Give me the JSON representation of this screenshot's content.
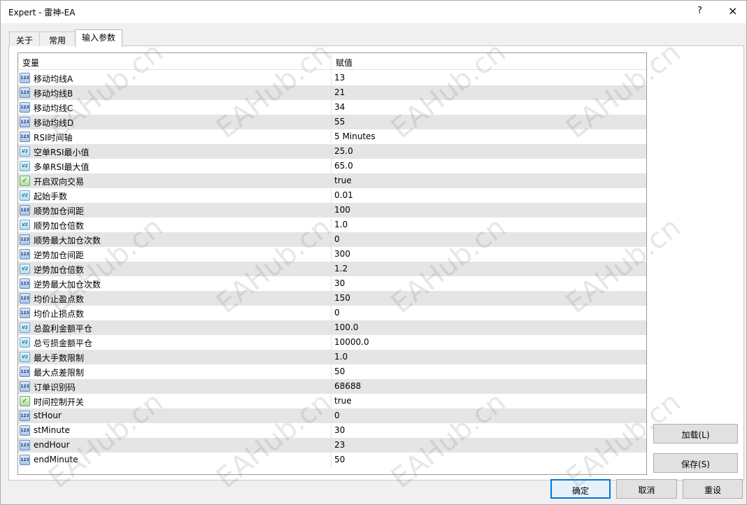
{
  "window": {
    "title": "Expert - 雷神-EA",
    "help_label": "?",
    "close_label": "×"
  },
  "tabs": [
    {
      "label": "关于"
    },
    {
      "label": "常用"
    },
    {
      "label": "输入参数"
    }
  ],
  "table": {
    "headers": [
      "变量",
      "赋值"
    ],
    "rows": [
      {
        "icon": "int",
        "icon_name": "integer-type-icon",
        "name": "移动均线A",
        "value": "13"
      },
      {
        "icon": "int",
        "icon_name": "integer-type-icon",
        "name": "移动均线B",
        "value": "21"
      },
      {
        "icon": "int",
        "icon_name": "integer-type-icon",
        "name": "移动均线C",
        "value": "34"
      },
      {
        "icon": "int",
        "icon_name": "integer-type-icon",
        "name": "移动均线D",
        "value": "55"
      },
      {
        "icon": "int",
        "icon_name": "integer-type-icon",
        "name": "RSI时间轴",
        "value": "5 Minutes"
      },
      {
        "icon": "dbl",
        "icon_name": "double-type-icon",
        "name": "空单RSI最小值",
        "value": "25.0"
      },
      {
        "icon": "dbl",
        "icon_name": "double-type-icon",
        "name": "多单RSI最大值",
        "value": "65.0"
      },
      {
        "icon": "bool",
        "icon_name": "boolean-type-icon",
        "name": "开启双向交易",
        "value": "true"
      },
      {
        "icon": "dbl",
        "icon_name": "double-type-icon",
        "name": "起始手数",
        "value": "0.01"
      },
      {
        "icon": "int",
        "icon_name": "integer-type-icon",
        "name": "顺势加仓间距",
        "value": "100"
      },
      {
        "icon": "dbl",
        "icon_name": "double-type-icon",
        "name": "顺势加仓倍数",
        "value": "1.0"
      },
      {
        "icon": "int",
        "icon_name": "integer-type-icon",
        "name": "顺势最大加仓次数",
        "value": "0"
      },
      {
        "icon": "int",
        "icon_name": "integer-type-icon",
        "name": "逆势加仓间距",
        "value": "300"
      },
      {
        "icon": "dbl",
        "icon_name": "double-type-icon",
        "name": "逆势加仓倍数",
        "value": "1.2"
      },
      {
        "icon": "int",
        "icon_name": "integer-type-icon",
        "name": "逆势最大加仓次数",
        "value": "30"
      },
      {
        "icon": "int",
        "icon_name": "integer-type-icon",
        "name": "均价止盈点数",
        "value": "150"
      },
      {
        "icon": "int",
        "icon_name": "integer-type-icon",
        "name": "均价止损点数",
        "value": "0"
      },
      {
        "icon": "dbl",
        "icon_name": "double-type-icon",
        "name": "总盈利金额平仓",
        "value": "100.0"
      },
      {
        "icon": "dbl",
        "icon_name": "double-type-icon",
        "name": "总亏损金额平仓",
        "value": "10000.0"
      },
      {
        "icon": "dbl",
        "icon_name": "double-type-icon",
        "name": "最大手数限制",
        "value": "1.0"
      },
      {
        "icon": "int",
        "icon_name": "integer-type-icon",
        "name": "最大点差限制",
        "value": "50"
      },
      {
        "icon": "int",
        "icon_name": "integer-type-icon",
        "name": "订单识别码",
        "value": "68688"
      },
      {
        "icon": "bool",
        "icon_name": "boolean-type-icon",
        "name": "时间控制开关",
        "value": "true"
      },
      {
        "icon": "int",
        "icon_name": "integer-type-icon",
        "name": "stHour",
        "value": "0"
      },
      {
        "icon": "int",
        "icon_name": "integer-type-icon",
        "name": "stMinute",
        "value": "30"
      },
      {
        "icon": "int",
        "icon_name": "integer-type-icon",
        "name": "endHour",
        "value": "23"
      },
      {
        "icon": "int",
        "icon_name": "integer-type-icon",
        "name": "endMinute",
        "value": "50"
      }
    ]
  },
  "icon_glyphs": {
    "int": "123",
    "dbl": "V2",
    "bool": "✓"
  },
  "buttons": {
    "load": "加载(L)",
    "save": "保存(S)",
    "ok": "确定",
    "cancel": "取消",
    "reset": "重设"
  },
  "watermark": "EAHub.cn",
  "colors": {
    "accent": "#0078d7",
    "row_alt": "#e5e5e5"
  }
}
